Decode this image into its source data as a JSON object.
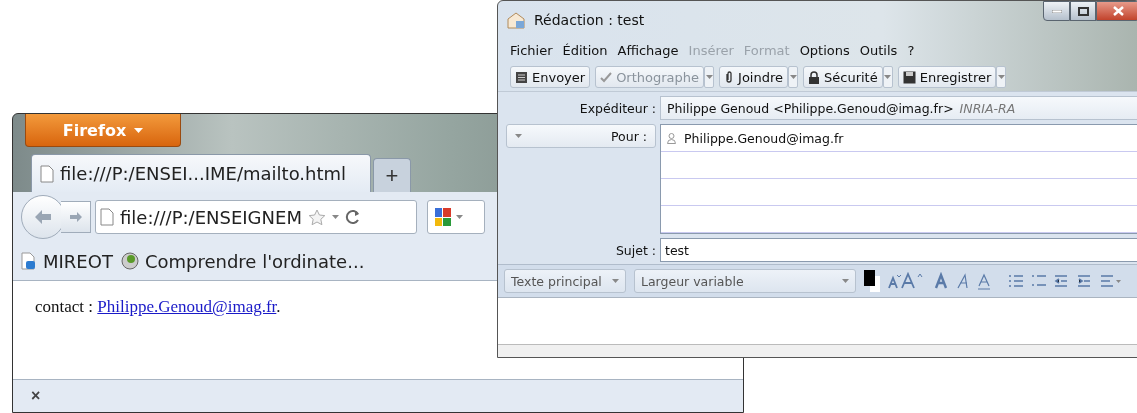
{
  "browser": {
    "app_button": "Firefox",
    "tab": {
      "title": "file:///P:/ENSEI...IME/mailto.html",
      "selected": true
    },
    "new_tab": "+",
    "address": "file:///P:/ENSEIGNEM",
    "bookmarks": [
      "MIREOT",
      "Comprendre l'ordinate..."
    ],
    "page": {
      "label": "contact :",
      "link": "Philippe.Genoud@imag.fr",
      "after": "."
    },
    "status_close": "×"
  },
  "compose": {
    "window": {
      "title": "Rédaction : test"
    },
    "menu": [
      {
        "label": "Fichier",
        "disabled": false
      },
      {
        "label": "Édition",
        "disabled": false
      },
      {
        "label": "Affichage",
        "disabled": false
      },
      {
        "label": "Insérer",
        "disabled": true
      },
      {
        "label": "Format",
        "disabled": true
      },
      {
        "label": "Options",
        "disabled": false
      },
      {
        "label": "Outils",
        "disabled": false
      },
      {
        "label": "?",
        "disabled": false
      }
    ],
    "toolbar": [
      {
        "label": "Envoyer",
        "kind": "send",
        "dropdown": false,
        "disabled": false
      },
      {
        "label": "Orthographe",
        "kind": "check",
        "dropdown": true,
        "disabled": true
      },
      {
        "label": "Joindre",
        "kind": "clip",
        "dropdown": true,
        "disabled": false
      },
      {
        "label": "Sécurité",
        "kind": "lock",
        "dropdown": true,
        "disabled": false
      },
      {
        "label": "Enregistrer",
        "kind": "save",
        "dropdown": true,
        "disabled": false
      }
    ],
    "sender": {
      "label": "Expéditeur :",
      "value": "Philippe Genoud <Philippe.Genoud@imag.fr>",
      "account": "INRIA-RA"
    },
    "recipient": {
      "label": "Pour :",
      "addresses": [
        "Philippe.Genoud@imag.fr"
      ]
    },
    "subject": {
      "label": "Sujet :",
      "value": "test"
    },
    "format": {
      "paragraph": "Texte principal",
      "font": "Largeur variable"
    }
  }
}
